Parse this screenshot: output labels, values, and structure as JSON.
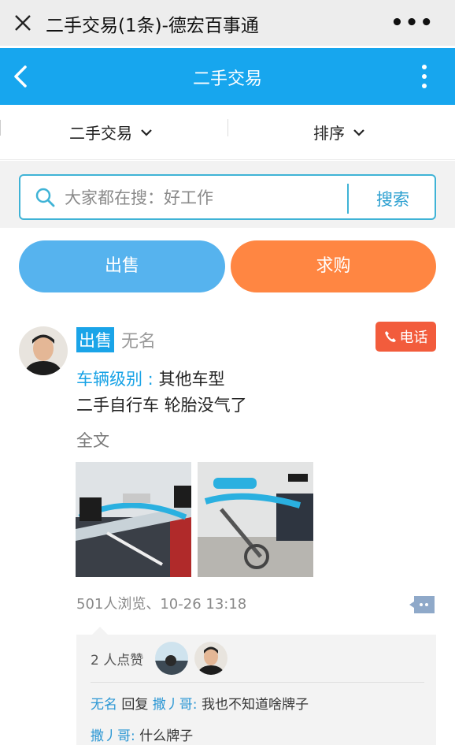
{
  "wechat_bar": {
    "title": "二手交易(1条)-德宏百事通",
    "more": "•••"
  },
  "nav": {
    "title": "二手交易"
  },
  "filters": [
    {
      "label": "二手交易"
    },
    {
      "label": "排序"
    }
  ],
  "search": {
    "placeholder": "大家都在搜：好工作",
    "button": "搜索"
  },
  "actions": {
    "sell": "出售",
    "buy": "求购"
  },
  "post": {
    "tag": "出售",
    "author": "无名",
    "phone_button": "电话",
    "field_key": "车辆级别 :",
    "field_value": "其他车型",
    "description": "二手自行车 轮胎没气了",
    "full_text_link": "全文",
    "meta": "501人浏览、10-26 13:18",
    "likes_text": "2 人点赞",
    "replies": [
      {
        "from": "无名",
        "verb": "回复",
        "to": "撒丿哥:",
        "text": "我也不知道啥牌子"
      },
      {
        "from": "撒丿哥:",
        "text": "什么牌子"
      }
    ]
  },
  "colors": {
    "nav_blue": "#17a6ee",
    "sell": "#56b3ee",
    "buy": "#ff8642",
    "phone": "#f25c3c"
  }
}
